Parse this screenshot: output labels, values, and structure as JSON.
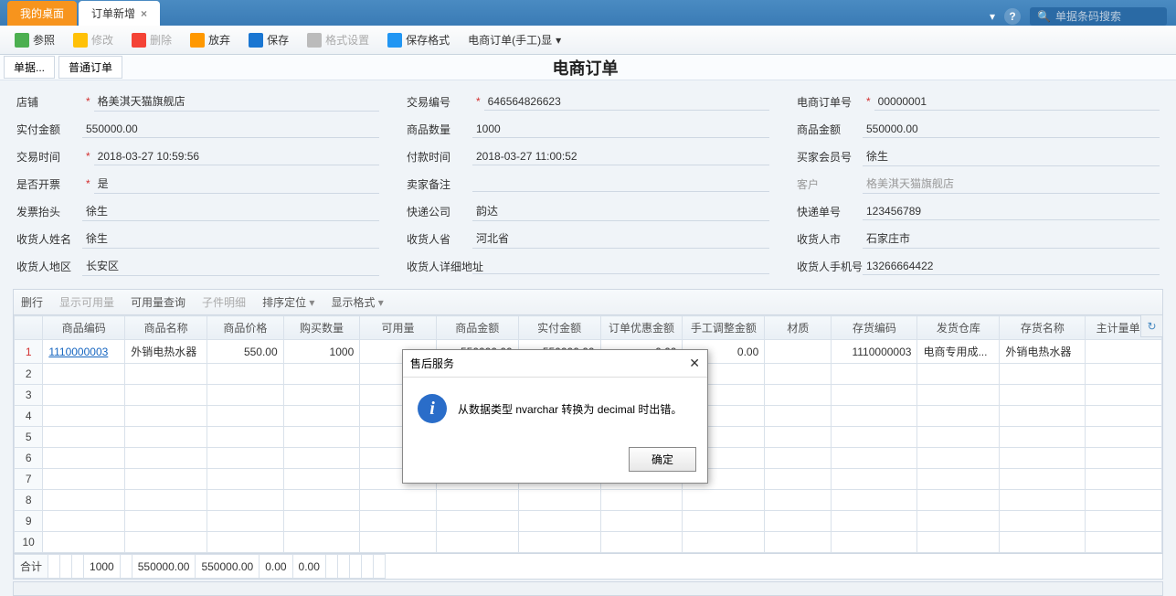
{
  "tabs": {
    "home": "我的桌面",
    "current": "订单新增"
  },
  "search": {
    "placeholder": "单据条码搜索"
  },
  "toolbar": {
    "ref": "参照",
    "edit": "修改",
    "del": "删除",
    "discard": "放弃",
    "save": "保存",
    "fmtset": "格式设置",
    "savefmt": "保存格式",
    "display": "电商订单(手工)显"
  },
  "subbar": {
    "btn1": "单据...",
    "btn2": "普通订单"
  },
  "page_title": "电商订单",
  "form": {
    "shop_l": "店铺",
    "shop_v": "格美淇天猫旗舰店",
    "trade_no_l": "交易编号",
    "trade_no_v": "646564826623",
    "ec_no_l": "电商订单号",
    "ec_no_v": "00000001",
    "paid_l": "实付金额",
    "paid_v": "550000.00",
    "qty_l": "商品数量",
    "qty_v": "1000",
    "amt_l": "商品金额",
    "amt_v": "550000.00",
    "trade_t_l": "交易时间",
    "trade_t_v": "2018-03-27 10:59:56",
    "pay_t_l": "付款时间",
    "pay_t_v": "2018-03-27 11:00:52",
    "buyer_l": "买家会员号",
    "buyer_v": "徐生",
    "inv_l": "是否开票",
    "inv_v": "是",
    "seller_note_l": "卖家备注",
    "seller_note_v": "",
    "cust_l": "客户",
    "cust_v": "格美淇天猫旗舰店",
    "inv_head_l": "发票抬头",
    "inv_head_v": "徐生",
    "express_co_l": "快递公司",
    "express_co_v": "韵达",
    "express_no_l": "快递单号",
    "express_no_v": "123456789",
    "recv_name_l": "收货人姓名",
    "recv_name_v": "徐生",
    "recv_prov_l": "收货人省",
    "recv_prov_v": "河北省",
    "recv_city_l": "收货人市",
    "recv_city_v": "石家庄市",
    "recv_area_l": "收货人地区",
    "recv_area_v": "长安区",
    "recv_addr_l": "收货人详细地址",
    "recv_addr_v": "",
    "recv_tel_l": "收货人手机号",
    "recv_tel_v": "13266664422"
  },
  "grid_toolbar": {
    "delrow": "删行",
    "avail": "显示可用量",
    "availq": "可用量查询",
    "subitem": "子件明细",
    "sort": "排序定位",
    "dispfmt": "显示格式"
  },
  "grid": {
    "headers": [
      "",
      "商品编码",
      "商品名称",
      "商品价格",
      "购买数量",
      "可用量",
      "商品金额",
      "实付金额",
      "订单优惠金额",
      "手工调整金额",
      "材质",
      "存货编码",
      "发货仓库",
      "存货名称",
      "主计量单位"
    ],
    "row": {
      "num": "1",
      "code": "1110000003",
      "name": "外销电热水器",
      "price": "550.00",
      "qty": "1000",
      "avail": "",
      "amount": "550000.00",
      "paid": "550000.00",
      "disc": "0.00",
      "adj": "0.00",
      "mat": "",
      "invcode": "1110000003",
      "wh": "电商专用成...",
      "invname": "外销电热水器",
      "uom": ""
    },
    "sum_label": "合计",
    "sum": {
      "qty": "1000",
      "amount": "550000.00",
      "paid": "550000.00",
      "disc": "0.00",
      "adj": "0.00"
    }
  },
  "modal": {
    "title": "售后服务",
    "msg": "从数据类型 nvarchar 转换为 decimal 时出错。",
    "ok": "确定"
  }
}
